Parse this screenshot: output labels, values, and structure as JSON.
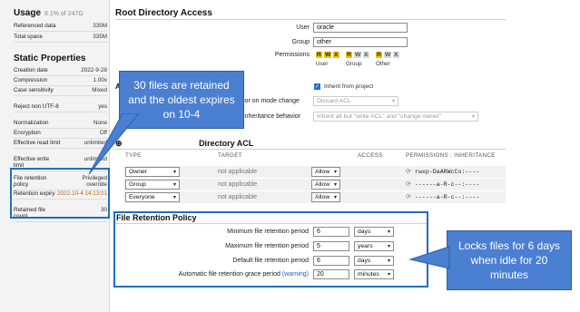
{
  "sidebar": {
    "usage": {
      "title": "Usage",
      "sub": "8.1% of 247G"
    },
    "usage_rows": [
      {
        "key": "Referenced data",
        "value": "335M"
      },
      {
        "key": "Total space",
        "value": "335M"
      }
    ],
    "static": {
      "title": "Static Properties"
    },
    "static_rows": [
      {
        "key": "Creation date",
        "value": "2022-9-28"
      },
      {
        "key": "Compression",
        "value": "1.00x"
      },
      {
        "key": "Case sensitivity",
        "value": "Mixed"
      },
      {
        "key": "Reject non UTF-8",
        "value": "yes"
      },
      {
        "key": "Normalization",
        "value": "None"
      },
      {
        "key": "Encryption",
        "value": "Off"
      },
      {
        "key": "Effective read limit",
        "value": "unlimited"
      },
      {
        "key": "Effective write limit",
        "value": "unlimited"
      }
    ],
    "retention_rows": [
      {
        "key": "File retention policy",
        "value": "Privileged override"
      },
      {
        "key": "Retention expiry",
        "value": "2022-10-4 14:13:01"
      },
      {
        "key": "Retained file count",
        "value": "30"
      }
    ]
  },
  "root_access": {
    "title": "Root Directory Access",
    "user_label": "User",
    "user_value": "oracle",
    "group_label": "Group",
    "group_value": "other",
    "permissions_label": "Permissions",
    "perm_groups": [
      {
        "caption": "User",
        "r": "R",
        "w": "W",
        "x": "X"
      },
      {
        "caption": "Group",
        "r": "R",
        "w": "W",
        "x": "X"
      },
      {
        "caption": "Other",
        "r": "R",
        "w": "W",
        "x": "X"
      }
    ],
    "inherit_label": "Inherit from project",
    "acl_mode_label": "ior on mode change",
    "acl_mode_value": "Discard ACL",
    "acl_inherit_label": "inheritance behavior",
    "acl_inherit_value": "Inherit all but \"write ACL\" and \"change owner\"",
    "partial_heading": "A"
  },
  "acl": {
    "title": "Directory ACL",
    "add_icon": "plus-circle-icon",
    "headers": {
      "type": "TYPE",
      "target": "TARGET",
      "access": "ACCESS",
      "perms": "PERMISSIONS : INHERITANCE"
    },
    "rows": [
      {
        "type": "Owner",
        "target": "not applicable",
        "access": "Allow",
        "perms": "rwxp-DaARWcCo:----"
      },
      {
        "type": "Group",
        "target": "not applicable",
        "access": "Allow",
        "perms": "------a-R-c--:----"
      },
      {
        "type": "Everyone",
        "target": "not applicable",
        "access": "Allow",
        "perms": "------a-R-c--:----"
      }
    ]
  },
  "retention_policy": {
    "title": "File Retention Policy",
    "fields": [
      {
        "label": "Minimum file retention period",
        "value": "6",
        "unit": "days"
      },
      {
        "label": "Maximum file retention period",
        "value": "5",
        "unit": "years"
      },
      {
        "label": "Default file retention period",
        "value": "6",
        "unit": "days"
      },
      {
        "label": "Automatic file retention grace period",
        "link": "(warning)",
        "value": "20",
        "unit": "minutes"
      }
    ]
  },
  "callouts": {
    "left": "30 files are retained and the oldest expires on 10-4",
    "right": "Locks files for 6 days when idle for 20 minutes"
  },
  "colors": {
    "accent": "#1f6fbf",
    "callout": "#4a7fd1",
    "perm_on": "#f5c300"
  }
}
